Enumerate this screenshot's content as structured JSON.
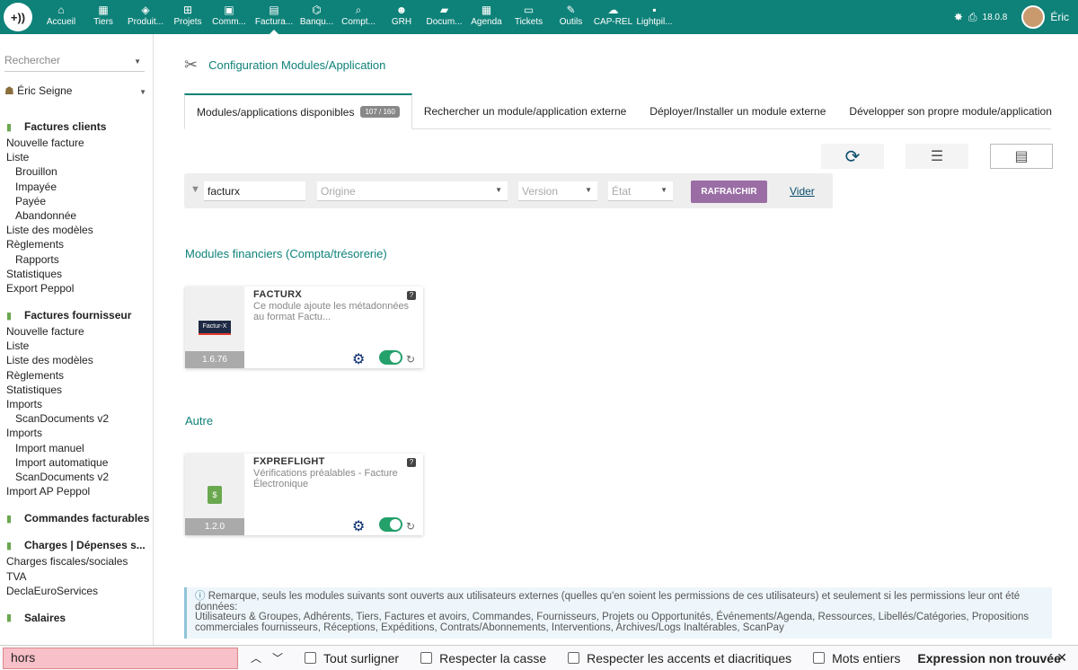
{
  "topbar": {
    "logo": "+))",
    "nav": [
      {
        "label": "Accueil",
        "icon": "home-icon",
        "glyph": "⌂",
        "w": 52
      },
      {
        "label": "Tiers",
        "icon": "building-icon",
        "glyph": "▦",
        "w": 42
      },
      {
        "label": "Produit...",
        "icon": "cube-icon",
        "glyph": "◈",
        "w": 52
      },
      {
        "label": "Projets",
        "icon": "project-icon",
        "glyph": "⊞",
        "w": 42
      },
      {
        "label": "Comm...",
        "icon": "briefcase-icon",
        "glyph": "▣",
        "w": 50
      },
      {
        "label": "Factura...",
        "icon": "invoice-icon",
        "glyph": "▤",
        "w": 50,
        "active": true
      },
      {
        "label": "Banqu...",
        "icon": "bank-icon",
        "glyph": "⌬",
        "w": 45
      },
      {
        "label": "Compt...",
        "icon": "search-dollar-icon",
        "glyph": "⌕",
        "w": 48
      },
      {
        "label": "GRH",
        "icon": "users-icon",
        "glyph": "☻",
        "w": 48
      },
      {
        "label": "Docum...",
        "icon": "folder-icon",
        "glyph": "▰",
        "w": 47
      },
      {
        "label": "Agenda",
        "icon": "calendar-icon",
        "glyph": "▦",
        "w": 47
      },
      {
        "label": "Tickets",
        "icon": "ticket-icon",
        "glyph": "▭",
        "w": 47
      },
      {
        "label": "Outils",
        "icon": "wrench-icon",
        "glyph": "✎",
        "w": 47
      },
      {
        "label": "CAP-REL",
        "icon": "cloud-icon",
        "glyph": "☁",
        "w": 47
      },
      {
        "label": "Lightpil...",
        "icon": "sticky-note-icon",
        "glyph": "▪",
        "w": 45
      }
    ],
    "version": "18.0.8",
    "user": "Éric"
  },
  "sidebar": {
    "search_placeholder": "Rechercher",
    "user": "Éric Seigne",
    "sections": [
      {
        "title": "Factures clients",
        "icon": "invoice-icon",
        "items": [
          {
            "label": "Nouvelle facture",
            "sub": false
          },
          {
            "label": "Liste",
            "sub": false
          },
          {
            "label": "Brouillon",
            "sub": true
          },
          {
            "label": "Impayée",
            "sub": true
          },
          {
            "label": "Payée",
            "sub": true
          },
          {
            "label": "Abandonnée",
            "sub": true
          },
          {
            "label": "Liste des modèles",
            "sub": false
          },
          {
            "label": "Règlements",
            "sub": false
          },
          {
            "label": "Rapports",
            "sub": true
          },
          {
            "label": "Statistiques",
            "sub": false
          },
          {
            "label": "Export Peppol",
            "sub": false
          }
        ]
      },
      {
        "title": "Factures fournisseur",
        "icon": "invoice-icon",
        "items": [
          {
            "label": "Nouvelle facture",
            "sub": false
          },
          {
            "label": "Liste",
            "sub": false
          },
          {
            "label": "Liste des modèles",
            "sub": false
          },
          {
            "label": "Règlements",
            "sub": false
          },
          {
            "label": "Statistiques",
            "sub": false
          },
          {
            "label": "Imports",
            "sub": false
          },
          {
            "label": "ScanDocuments v2",
            "sub": true
          },
          {
            "label": "Imports",
            "sub": false
          },
          {
            "label": "Import manuel",
            "sub": true
          },
          {
            "label": "Import automatique",
            "sub": true
          },
          {
            "label": "ScanDocuments v2",
            "sub": true
          },
          {
            "label": "Import AP Peppol",
            "sub": false
          }
        ]
      },
      {
        "title": "Commandes facturables",
        "icon": "order-icon",
        "items": []
      },
      {
        "title": "Charges | Dépenses s...",
        "icon": "money-icon",
        "items": [
          {
            "label": "Charges fiscales/sociales",
            "sub": false
          },
          {
            "label": "TVA",
            "sub": false
          },
          {
            "label": "DeclaEuroServices",
            "sub": false
          }
        ]
      },
      {
        "title": "Salaires",
        "icon": "wallet-icon",
        "items": []
      }
    ]
  },
  "main": {
    "title": "Configuration Modules/Application",
    "tabs": [
      {
        "label": "Modules/applications disponibles",
        "badge": "107 / 160",
        "active": true
      },
      {
        "label": "Rechercher un module/application externe"
      },
      {
        "label": "Déployer/Installer un module externe"
      },
      {
        "label": "Développer son propre module/application"
      }
    ],
    "filters": {
      "search_value": "facturx",
      "origine_placeholder": "Origine",
      "version_placeholder": "Version",
      "etat_placeholder": "État",
      "refresh_label": "RAFRAICHIR",
      "clear_label": "Vider"
    },
    "sections": [
      {
        "title": "Modules financiers (Compta/trésorerie)",
        "module": {
          "name": "FACTURX",
          "desc": "Ce module ajoute les métadonnées au format Factu...",
          "version": "1.6.76",
          "logo_text": "Factur-X",
          "enabled": true
        }
      },
      {
        "title": "Autre",
        "module": {
          "name": "FXPREFLIGHT",
          "desc": "Vérifications préalables - Facture Électronique",
          "version": "1.2.0",
          "logo_text": "$",
          "enabled": true
        }
      }
    ],
    "note": {
      "text": "Remarque, seuls les modules suivants sont ouverts aux utilisateurs externes (quelles qu'en soient les permissions de ces utilisateurs) et seulement si les permissions leur ont été données:",
      "modules": "Utilisateurs & Groupes, Adhérents, Tiers, Factures et avoirs, Commandes, Fournisseurs, Projets ou Opportunités, Événements/Agenda, Ressources, Libellés/Catégories, Propositions commerciales fournisseurs, Réceptions, Expéditions, Contrats/Abonnements, Interventions, Archives/Logs Inaltérables, ScanPay"
    }
  },
  "findbar": {
    "value": "hors",
    "highlight_all": "Tout surligner",
    "match_case": "Respecter la casse",
    "match_diacritics": "Respecter les accents et diacritiques",
    "whole_words": "Mots entiers",
    "status": "Expression non trouvée"
  },
  "colors": {
    "primary": "#0e8279",
    "refresh_button": "#9a6ea5",
    "toggle_on": "#24a06b"
  }
}
